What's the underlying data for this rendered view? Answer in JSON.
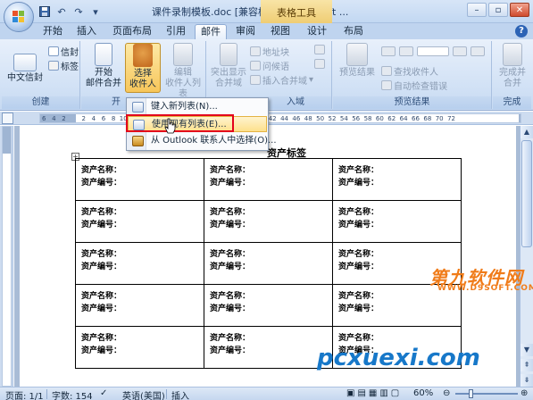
{
  "titlebar": {
    "document_title": "课件录制模板.doc [兼容模式] - Microsoft ...",
    "context_tab_label": "表格工具"
  },
  "tabs": [
    "开始",
    "插入",
    "页面布局",
    "引用",
    "邮件",
    "审阅",
    "视图",
    "设计",
    "布局"
  ],
  "active_tab": "邮件",
  "ribbon": {
    "groups": {
      "create": "创建",
      "start_merge": "开",
      "write_insert": "入域",
      "preview": "预览结果",
      "finish": "完成"
    },
    "buttons": {
      "chinese_envelope": "中文信封",
      "envelope": "信封",
      "label": "标签",
      "start_merge": "开始\n邮件合并",
      "select_recipients": "选择\n收件人",
      "edit_recipients": "编辑\n收件人列表",
      "highlight_fields": "突出显示\n合并域",
      "address_block": "地址块",
      "greeting_line": "问候语",
      "insert_merge_field": "插入合并域",
      "preview_results": "预览结果",
      "find_recipient": "查找收件人",
      "auto_check": "自动检查错误",
      "finish_merge": "完成并\n合并"
    }
  },
  "ruler": {
    "numbers": "6   4   2        2   4   6   8  10  12                                               36  38  40  42  44  46  48  50  52  54  56  58  60  62  64  66  68  70  72"
  },
  "dropdown_menu": {
    "items": [
      "键入新列表(N)...",
      "使用现有列表(E)...",
      "从 Outlook 联系人中选择(O)..."
    ]
  },
  "document": {
    "title": "资产标签",
    "cell_line1": "资产名称：",
    "cell_line2": "资产编号："
  },
  "statusbar": {
    "page": "页面: 1/1",
    "words": "字数: 154",
    "language": "英语(美国)",
    "mode": "插入",
    "zoom": "60%"
  },
  "watermarks": {
    "site1": "第九软件网",
    "site1_url": "WWW.D9SOFT.COM",
    "site2": "pcxuexi.com"
  },
  "colors": {
    "ribbon": "#d4e3f6",
    "context_tab": "#efcd74",
    "highlight_border": "#e3001b",
    "watermark_orange": "#f07c1a",
    "watermark_blue": "#1778c9"
  }
}
